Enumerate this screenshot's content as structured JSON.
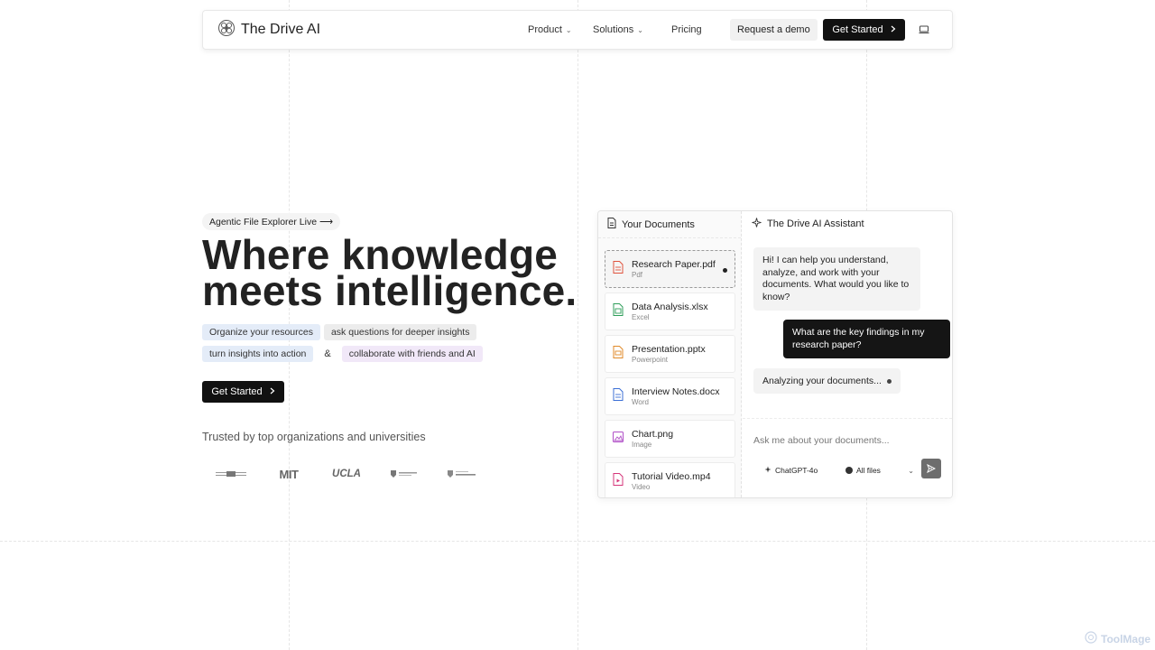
{
  "nav": {
    "brand": "The Drive AI",
    "links": [
      {
        "label": "Product",
        "has_dropdown": true
      },
      {
        "label": "Solutions",
        "has_dropdown": true
      },
      {
        "label": "Pricing",
        "has_dropdown": false
      }
    ],
    "demo_button": "Request a demo",
    "start_button": "Get Started",
    "icons": {
      "logo": "brain-icon",
      "chevron": "chevron-right-icon",
      "monitor": "monitor-icon"
    }
  },
  "hero": {
    "badge": "Agentic File Explorer Live ⟶",
    "title_line1": "Where knowledge",
    "title_line2": "meets intelligence.",
    "tags": {
      "organize": "Organize your resources",
      "ask": "ask questions for deeper insights",
      "turn": "turn insights into action",
      "amp": "&",
      "collaborate": "collaborate with friends and AI"
    },
    "cta": "Get Started",
    "trusted": "Trusted by top organizations and universities",
    "logos": [
      "michigan-logo",
      "mit-logo",
      "ucla-logo",
      "harvard-logo",
      "toronto-logo"
    ],
    "logo_text": {
      "mit": "MIT",
      "ucla": "UCLA"
    }
  },
  "documents": {
    "title": "Your Documents",
    "files": [
      {
        "name": "Research Paper.pdf",
        "type": "Pdf",
        "color": "#e0533d",
        "selected": true
      },
      {
        "name": "Data Analysis.xlsx",
        "type": "Excel",
        "color": "#2f9e5a",
        "selected": false
      },
      {
        "name": "Presentation.pptx",
        "type": "Powerpoint",
        "color": "#e08a2a",
        "selected": false
      },
      {
        "name": "Interview Notes.docx",
        "type": "Word",
        "color": "#3b6fd6",
        "selected": false
      },
      {
        "name": "Chart.png",
        "type": "Image",
        "color": "#b04fc7",
        "selected": false
      },
      {
        "name": "Tutorial Video.mp4",
        "type": "Video",
        "color": "#d6357a",
        "selected": false
      }
    ]
  },
  "assistant": {
    "title": "The Drive AI Assistant",
    "ai_message": "Hi! I can help you understand, analyze, and work with your documents. What would you like to know?",
    "user_message": "What are the key findings in my research paper?",
    "status": "Analyzing your documents...",
    "input_placeholder": "Ask me about your documents...",
    "model": "ChatGPT-4o",
    "files_filter": "All files"
  },
  "watermark": "ToolMage"
}
